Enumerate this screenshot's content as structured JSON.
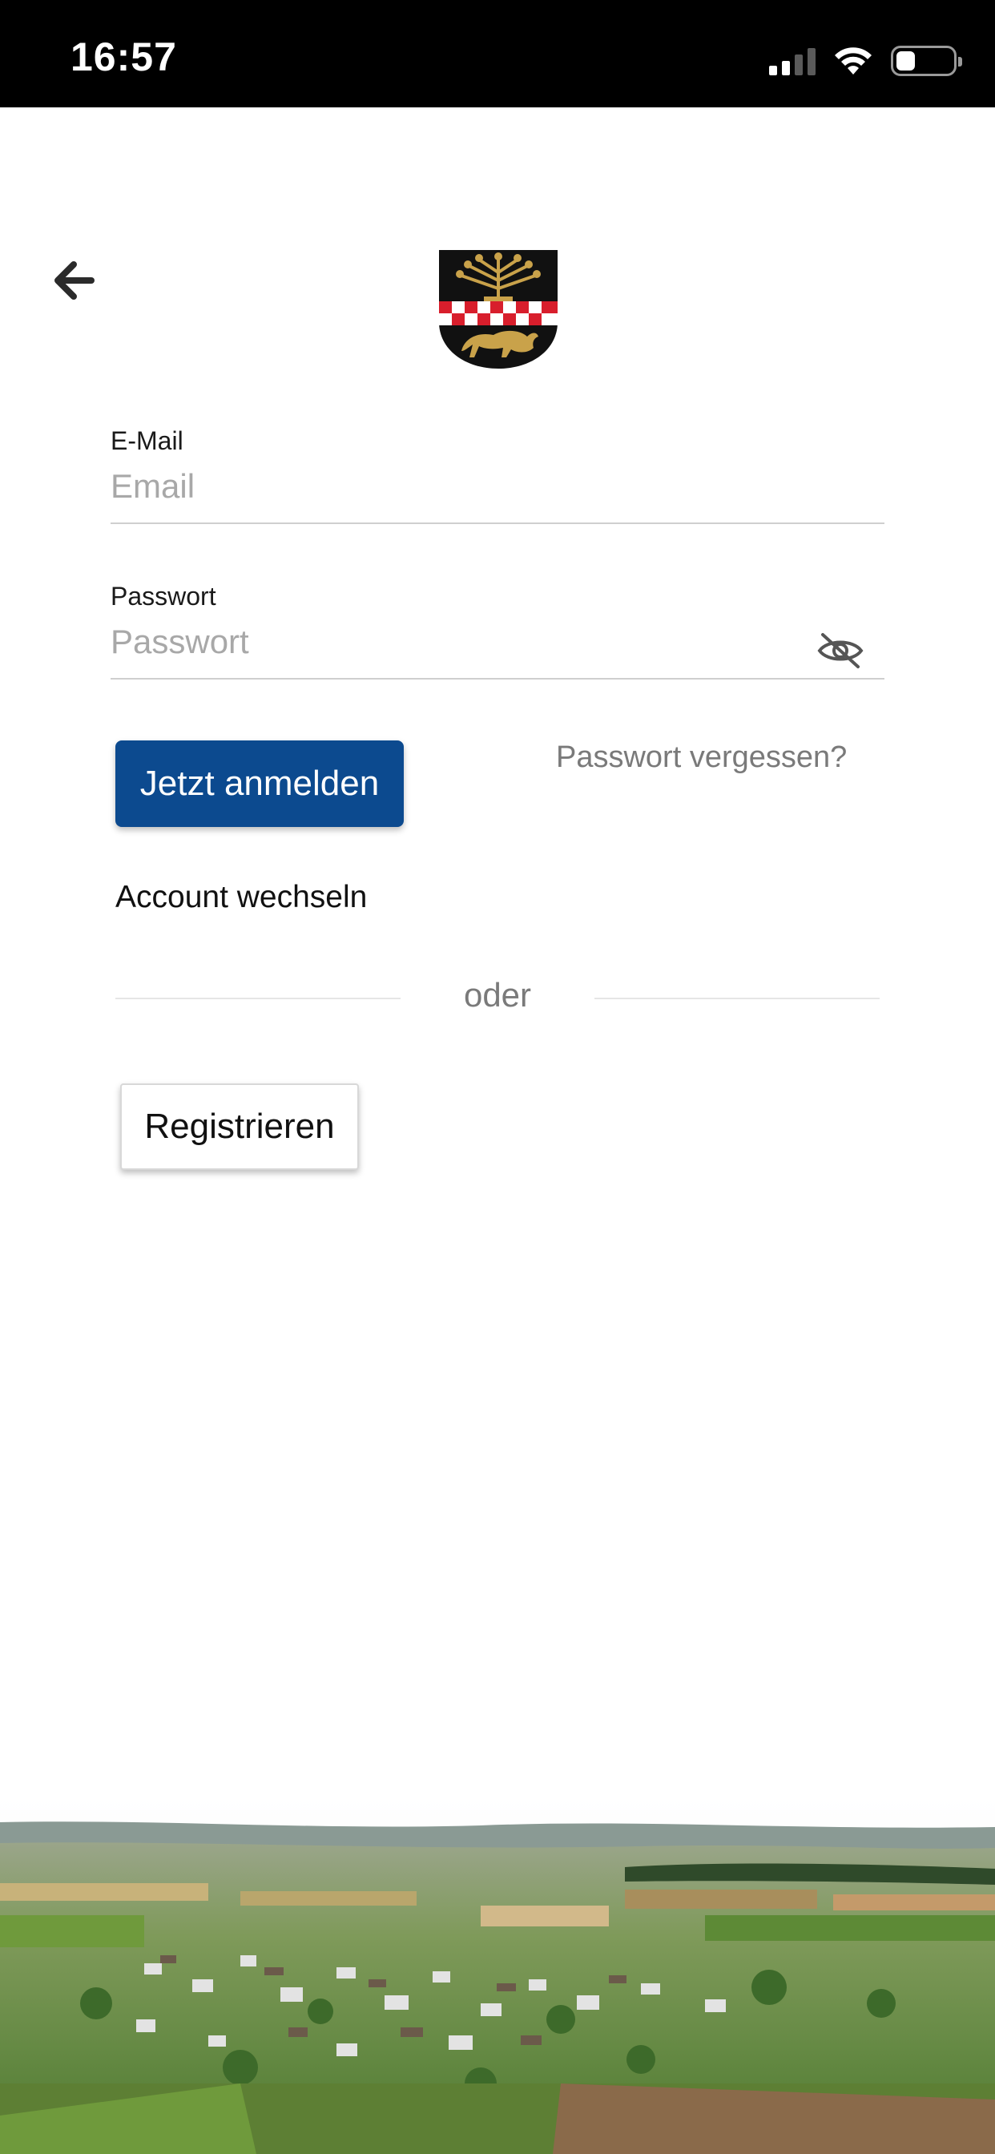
{
  "status_bar": {
    "time": "16:57",
    "icons": [
      "cellular-signal-icon",
      "wifi-icon",
      "battery-icon"
    ],
    "battery_level": 0.34
  },
  "header": {
    "back_icon": "arrow-left-icon",
    "logo_icon": "coat-of-arms-logo"
  },
  "form": {
    "email": {
      "label": "E-Mail",
      "placeholder": "Email",
      "value": ""
    },
    "password": {
      "label": "Passwort",
      "placeholder": "Passwort",
      "value": "",
      "toggle_icon": "eye-slash-icon"
    }
  },
  "actions": {
    "login_label": "Jetzt anmelden",
    "forgot_label": "Passwort vergessen?",
    "switch_account_label": "Account wechseln",
    "divider_label": "oder",
    "register_label": "Registrieren"
  },
  "colors": {
    "primary": "#0c4a8f",
    "status_bar_bg": "#000000",
    "muted_text": "#7a7a7a",
    "placeholder": "#a8a8a8",
    "shield_black": "#111111",
    "shield_gold": "#c9a24a",
    "shield_red": "#d81e2c"
  },
  "background": {
    "image": "landscape-village-photo"
  }
}
